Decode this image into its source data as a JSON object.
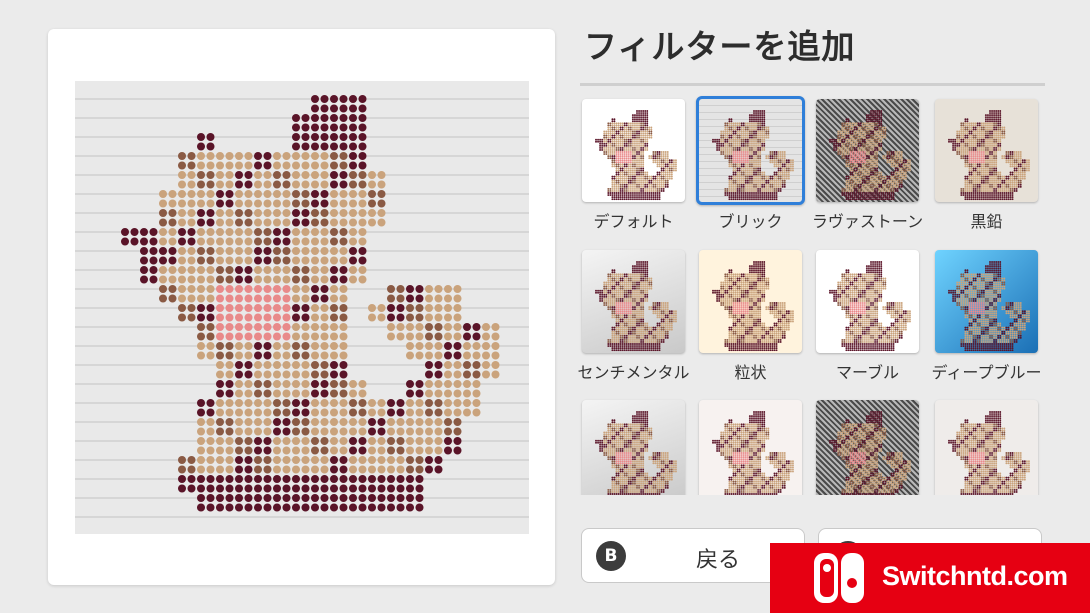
{
  "panel": {
    "title": "フィルターを追加"
  },
  "preview": {
    "selected_filter": "ブリック",
    "palette": {
      "dark": "#5a1428",
      "mid": "#8a5a44",
      "tan": "#caa37c",
      "pink": "#e98a8a"
    }
  },
  "filters": [
    {
      "label": "デフォルト",
      "style": "default",
      "selected": false
    },
    {
      "label": "ブリック",
      "style": "brick",
      "selected": true
    },
    {
      "label": "ラヴァストーン",
      "style": "lava",
      "selected": false
    },
    {
      "label": "黒鉛",
      "style": "graphite",
      "selected": false
    },
    {
      "label": "センチメンタル",
      "style": "sentimental",
      "selected": false
    },
    {
      "label": "粒状",
      "style": "grain",
      "selected": false
    },
    {
      "label": "マーブル",
      "style": "marble",
      "selected": false
    },
    {
      "label": "ディープブルー",
      "style": "deepblue",
      "selected": false
    },
    {
      "label": "",
      "style": "paper",
      "selected": false
    },
    {
      "label": "",
      "style": "faded",
      "selected": false
    },
    {
      "label": "",
      "style": "noise",
      "selected": false
    },
    {
      "label": "",
      "style": "rain",
      "selected": false
    }
  ],
  "buttons": {
    "back": {
      "badge": "B",
      "label": "戻る"
    },
    "ok": {
      "badge": "A",
      "label": ""
    }
  },
  "watermark": {
    "text": "Switchntd.com",
    "color": "#e60012"
  }
}
